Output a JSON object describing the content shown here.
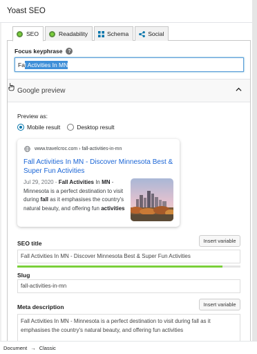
{
  "panel": {
    "title": "Yoast SEO"
  },
  "tabs": [
    {
      "label": "SEO",
      "icon": "seo-score-dot-icon",
      "active": true
    },
    {
      "label": "Readability",
      "icon": "readability-score-dot-icon",
      "active": false
    },
    {
      "label": "Schema",
      "icon": "schema-grid-icon",
      "active": false
    },
    {
      "label": "Social",
      "icon": "share-icon",
      "active": false
    }
  ],
  "focus_keyphrase": {
    "label": "Focus keyphrase",
    "value_prefix": "Fa",
    "value_selected": "l Activities In MN"
  },
  "google_preview": {
    "heading": "Google preview",
    "preview_as_label": "Preview as:",
    "options": [
      "Mobile result",
      "Desktop result"
    ],
    "selected": "Mobile result",
    "card": {
      "url": "www.travelcroc.com › fall-activities-in-mn",
      "title": "Fall Activities In MN - Discover Minnesota Best & Super Fun Activities",
      "date": "Jul 29, 2020 - ",
      "desc_parts": [
        {
          "text": "",
          "bold": false
        },
        {
          "text": "Fall Activities",
          "bold": true
        },
        {
          "text": " In ",
          "bold": false
        },
        {
          "text": "MN",
          "bold": true
        },
        {
          "text": " - Minnesota is a perfect destination to visit during ",
          "bold": false
        },
        {
          "text": "fall",
          "bold": true
        },
        {
          "text": " as it emphasises the country's natural beauty, and offering fun ",
          "bold": false
        },
        {
          "text": "activities",
          "bold": true
        }
      ]
    }
  },
  "seo_title": {
    "label": "SEO title",
    "insert_label": "Insert variable",
    "value": "Fall Activities In MN - Discover Minnesota Best & Super Fun Activities",
    "progress": 0.92,
    "progress_color": "#7ad03a"
  },
  "slug": {
    "label": "Slug",
    "value": "fall-activities-in-mn"
  },
  "meta_description": {
    "label": "Meta description",
    "insert_label": "Insert variable",
    "value": "Fall Activities In MN - Minnesota is a perfect destination to visit during fall as it emphasises the country's natural beauty, and offering fun activities"
  },
  "footer": {
    "crumb1": "Document",
    "arrow": "→",
    "crumb2": "Classic"
  },
  "colors": {
    "link": "#1a65d6",
    "accent": "#0073aa",
    "focus_border": "#5b9dd9"
  }
}
